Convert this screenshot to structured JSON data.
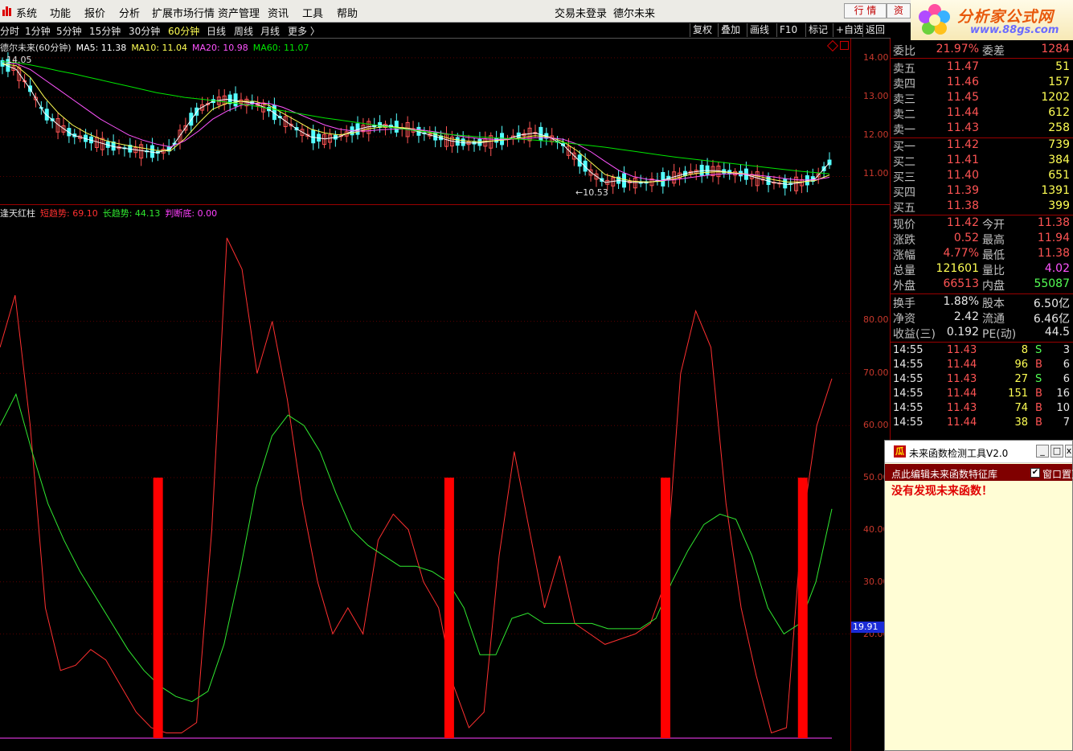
{
  "menu": {
    "items": [
      "系统",
      "功能",
      "报价",
      "分析",
      "扩展市场行情",
      "资产管理",
      "资讯",
      "工具",
      "帮助"
    ],
    "login_status": "交易未登录",
    "stock_name": "德尔未来",
    "btn_quote": "行 情",
    "btn_trade": "资",
    "brand_title": "分析家公式网",
    "brand_url": "www.88gs.com"
  },
  "periods": {
    "items": [
      "分时",
      "1分钟",
      "5分钟",
      "15分钟",
      "30分钟",
      "60分钟",
      "日线",
      "周线",
      "月线",
      "更多 〉"
    ],
    "active": "60分钟",
    "tools": [
      "复权",
      "叠加",
      "画线",
      "F10",
      "标记",
      "+自选",
      "返回"
    ]
  },
  "main_chart": {
    "title": "德尔未来(60分钟)",
    "ma5": "MA5: 11.38",
    "ma10": "MA10: 11.04",
    "ma20": "MA20: 10.98",
    "ma60": "MA60: 11.07",
    "high_label": "14.05",
    "low_label": "←10.53",
    "y_ticks": [
      "14.00",
      "13.00",
      "12.00",
      "11.00"
    ],
    "colors": {
      "ma5": "#ffffff",
      "ma10": "#ffff54",
      "ma20": "#ff54ff",
      "ma60": "#00e600",
      "up": "#ff5454",
      "down": "#54ffff"
    }
  },
  "chart_data": [
    {
      "type": "line",
      "title": "",
      "series": [
        {
          "name": "MA5",
          "values": [
            13.85,
            13.7,
            13.2,
            12.6,
            12.3,
            12.05,
            11.95,
            11.85,
            11.75,
            11.7,
            11.65,
            11.6,
            11.7,
            12.2,
            12.7,
            12.9,
            12.95,
            12.9,
            12.85,
            12.7,
            12.45,
            12.2,
            12.0,
            11.95,
            12.0,
            12.15,
            12.25,
            12.3,
            12.25,
            12.2,
            12.1,
            12.0,
            11.9,
            11.85,
            11.85,
            11.9,
            11.95,
            12.05,
            12.1,
            12.0,
            11.8,
            11.45,
            11.1,
            10.85,
            10.9,
            10.85,
            10.85,
            10.9,
            11.0,
            11.1,
            11.15,
            11.15,
            11.1,
            11.05,
            10.95,
            10.85,
            10.8,
            10.85,
            10.95,
            11.35
          ]
        },
        {
          "name": "MA10",
          "values": [
            13.85,
            13.8,
            13.5,
            13.0,
            12.6,
            12.3,
            12.1,
            11.95,
            11.85,
            11.78,
            11.72,
            11.66,
            11.65,
            11.95,
            12.35,
            12.7,
            12.85,
            12.9,
            12.9,
            12.8,
            12.6,
            12.4,
            12.2,
            12.1,
            12.05,
            12.1,
            12.2,
            12.25,
            12.25,
            12.22,
            12.15,
            12.05,
            11.95,
            11.9,
            11.88,
            11.9,
            11.93,
            11.98,
            12.03,
            12.0,
            11.88,
            11.65,
            11.35,
            11.05,
            10.95,
            10.88,
            10.86,
            10.88,
            10.95,
            11.05,
            11.1,
            11.12,
            11.1,
            11.07,
            11.0,
            10.92,
            10.86,
            10.86,
            10.9,
            11.04
          ]
        },
        {
          "name": "MA20",
          "values": [
            13.9,
            13.85,
            13.7,
            13.45,
            13.2,
            12.95,
            12.7,
            12.45,
            12.25,
            12.05,
            11.92,
            11.82,
            11.75,
            11.9,
            12.15,
            12.45,
            12.65,
            12.8,
            12.85,
            12.85,
            12.75,
            12.6,
            12.45,
            12.3,
            12.2,
            12.15,
            12.15,
            12.18,
            12.2,
            12.2,
            12.17,
            12.12,
            12.06,
            12.0,
            11.96,
            11.94,
            11.94,
            11.95,
            11.98,
            11.98,
            11.94,
            11.82,
            11.62,
            11.38,
            11.15,
            11.0,
            10.93,
            10.9,
            10.92,
            10.97,
            11.02,
            11.06,
            11.07,
            11.06,
            11.03,
            10.99,
            10.94,
            10.91,
            10.92,
            10.98
          ]
        },
        {
          "name": "MA60",
          "values": [
            13.9,
            13.88,
            13.82,
            13.75,
            13.67,
            13.6,
            13.52,
            13.44,
            13.36,
            13.28,
            13.2,
            13.12,
            13.06,
            13.0,
            12.96,
            12.92,
            12.88,
            12.83,
            12.78,
            12.72,
            12.66,
            12.6,
            12.54,
            12.48,
            12.43,
            12.38,
            12.33,
            12.28,
            12.23,
            12.18,
            12.14,
            12.1,
            12.06,
            12.03,
            12.0,
            11.98,
            11.96,
            11.94,
            11.92,
            11.89,
            11.86,
            11.82,
            11.78,
            11.74,
            11.69,
            11.64,
            11.59,
            11.54,
            11.49,
            11.45,
            11.41,
            11.37,
            11.33,
            11.29,
            11.25,
            11.21,
            11.17,
            11.13,
            11.1,
            11.07
          ]
        }
      ],
      "ylim": [
        10.3,
        14.2
      ],
      "grid": true
    },
    {
      "type": "line",
      "title": "",
      "indicator_name": "逢天红柱",
      "series": [
        {
          "name": "短趋势",
          "values": [
            75,
            85,
            60,
            25,
            13,
            14,
            17,
            15,
            10,
            5,
            2,
            1,
            1,
            3,
            40,
            96,
            90,
            70,
            80,
            65,
            45,
            30,
            20,
            25,
            20,
            38,
            43,
            40,
            30,
            25,
            10,
            2,
            5,
            35,
            55,
            40,
            25,
            35,
            22,
            20,
            18,
            19,
            20,
            22,
            30,
            70,
            82,
            75,
            45,
            25,
            12,
            1,
            2,
            40,
            60,
            69
          ]
        },
        {
          "name": "长趋势",
          "values": [
            60,
            66,
            55,
            45,
            38,
            32,
            27,
            22,
            17,
            13,
            10,
            8,
            7,
            9,
            18,
            32,
            48,
            58,
            62,
            60,
            55,
            47,
            40,
            37,
            35,
            33,
            33,
            32,
            30,
            25,
            16,
            16,
            23,
            24,
            22,
            22,
            22,
            22,
            21,
            21,
            21,
            23,
            30,
            36,
            41,
            43,
            42,
            35,
            25,
            20,
            22,
            30,
            44
          ]
        },
        {
          "name": "判断底",
          "values": [
            0
          ]
        }
      ],
      "signal_bars": [
        {
          "at_pct": 0.19,
          "height": 50
        },
        {
          "at_pct": 0.54,
          "height": 50
        },
        {
          "at_pct": 0.8,
          "height": 50
        },
        {
          "at_pct": 0.965,
          "height": 50
        }
      ],
      "ylim": [
        0,
        100
      ],
      "grid": true
    }
  ],
  "indicator": {
    "name": "逢天红柱",
    "short": "短趋势: 69.10",
    "long": "长趋势: 44.13",
    "bottom": "判断底: 0.00",
    "y_ticks": [
      "80.00",
      "70.00",
      "60.00",
      "50.00",
      "40.00",
      "30.00",
      "20.00"
    ],
    "last_value": "19.91",
    "colors": {
      "short": "#ff3030",
      "long": "#30e830",
      "bottom": "#ff40ff",
      "bar": "#ff0000"
    }
  },
  "quote": {
    "weibi_label": "委比",
    "weibi_value": "21.97%",
    "weicha_label": "委差",
    "weicha_value": "1284",
    "sells": [
      {
        "label": "卖五",
        "price": "11.47",
        "vol": "51"
      },
      {
        "label": "卖四",
        "price": "11.46",
        "vol": "157"
      },
      {
        "label": "卖三",
        "price": "11.45",
        "vol": "1202"
      },
      {
        "label": "卖二",
        "price": "11.44",
        "vol": "612"
      },
      {
        "label": "卖一",
        "price": "11.43",
        "vol": "258"
      }
    ],
    "buys": [
      {
        "label": "买一",
        "price": "11.42",
        "vol": "739"
      },
      {
        "label": "买二",
        "price": "11.41",
        "vol": "384"
      },
      {
        "label": "买三",
        "price": "11.40",
        "vol": "651"
      },
      {
        "label": "买四",
        "price": "11.39",
        "vol": "1391"
      },
      {
        "label": "买五",
        "price": "11.38",
        "vol": "399"
      }
    ],
    "stats": [
      {
        "l1": "现价",
        "v1": "11.42",
        "c1": "#ff5454",
        "l2": "今开",
        "v2": "11.38",
        "c2": "#ff5454"
      },
      {
        "l1": "涨跌",
        "v1": "0.52",
        "c1": "#ff5454",
        "l2": "最高",
        "v2": "11.94",
        "c2": "#ff5454"
      },
      {
        "l1": "涨幅",
        "v1": "4.77%",
        "c1": "#ff5454",
        "l2": "最低",
        "v2": "11.38",
        "c2": "#ff5454"
      },
      {
        "l1": "总量",
        "v1": "121601",
        "c1": "#ffff54",
        "l2": "量比",
        "v2": "4.02",
        "c2": "#ff54ff"
      },
      {
        "l1": "外盘",
        "v1": "66513",
        "c1": "#ff5454",
        "l2": "内盘",
        "v2": "55087",
        "c2": "#54ff54"
      }
    ],
    "fund": [
      {
        "l1": "换手",
        "v1": "1.88%",
        "l2": "股本",
        "v2": "6.50亿"
      },
      {
        "l1": "净资",
        "v1": "2.42",
        "l2": "流通",
        "v2": "6.46亿"
      },
      {
        "l1": "收益(三)",
        "v1": "0.192",
        "l2": "PE(动)",
        "v2": "44.5"
      }
    ],
    "ticks": [
      {
        "time": "14:55",
        "price": "11.43",
        "vol": "8",
        "bs": "S",
        "n": "3"
      },
      {
        "time": "14:55",
        "price": "11.44",
        "vol": "96",
        "bs": "B",
        "n": "6"
      },
      {
        "time": "14:55",
        "price": "11.43",
        "vol": "27",
        "bs": "S",
        "n": "6"
      },
      {
        "time": "14:55",
        "price": "11.44",
        "vol": "151",
        "bs": "B",
        "n": "16"
      },
      {
        "time": "14:55",
        "price": "11.43",
        "vol": "74",
        "bs": "B",
        "n": "10"
      },
      {
        "time": "14:55",
        "price": "11.44",
        "vol": "38",
        "bs": "B",
        "n": "7"
      }
    ]
  },
  "popup": {
    "title": "未来函数检测工具V2.0",
    "edit_link": "点此编辑未来函数特征库",
    "pin_label": "窗口置顶",
    "message": "没有发现未来函数！"
  }
}
